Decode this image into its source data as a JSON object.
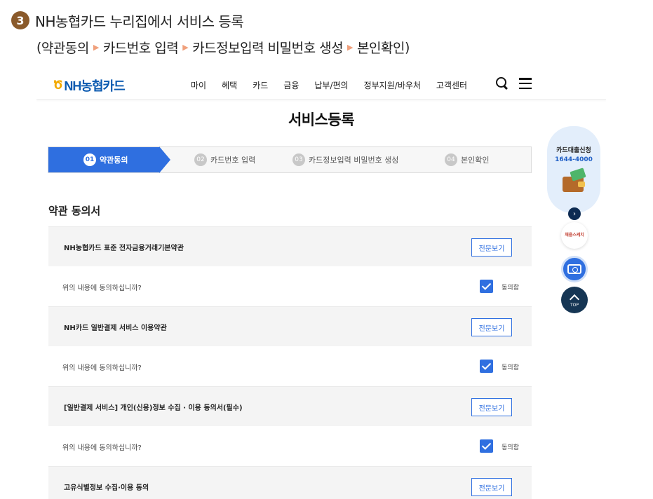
{
  "caption": {
    "step_number": "3",
    "title": "NH농협카드 누리집에서 서비스 등록",
    "flow_open": "(",
    "flow": [
      "약관동의",
      "카드번호 입력",
      "카드정보입력 비밀번호 생성",
      "본인확인"
    ],
    "flow_close": ")",
    "arrow_glyph": "▶"
  },
  "header": {
    "logo_mark": "Ծ",
    "logo_text": "NH농협카드",
    "nav": [
      "마이",
      "혜택",
      "카드",
      "금융",
      "납부/편의",
      "정부지원/바우처",
      "고객센터"
    ],
    "search_icon": "search-icon",
    "menu_icon": "hamburger-icon"
  },
  "page_title": "서비스등록",
  "steps": [
    {
      "num": "01",
      "label": "약관동의",
      "active": true
    },
    {
      "num": "02",
      "label": "카드번호 입력",
      "active": false
    },
    {
      "num": "03",
      "label": "카드정보입력 비밀번호 생성",
      "active": false
    },
    {
      "num": "04",
      "label": "본인확인",
      "active": false
    }
  ],
  "section_title": "약관 동의서",
  "terms": [
    {
      "title": "NH농협카드 표준 전자금융거래기본약관",
      "view_label": "전문보기",
      "question": "위의 내용에 동의하십니까?",
      "agree_label": "동의함",
      "checked": true
    },
    {
      "title": "NH카드 일반결제 서비스 이용약관",
      "view_label": "전문보기",
      "question": "위의 내용에 동의하십니까?",
      "agree_label": "동의함",
      "checked": true
    },
    {
      "title": "[일반결제 서비스] 개인(신용)정보 수집 · 이용 동의서(필수)",
      "view_label": "전문보기",
      "question": "위의 내용에 동의하십니까?",
      "agree_label": "동의함",
      "checked": true
    },
    {
      "title": "고유식별정보 수집·이용 동의",
      "view_label": "전문보기"
    }
  ],
  "quick_menu": {
    "loan_title": "카드대출신청",
    "loan_phone": "1644-4000",
    "next_glyph": "›",
    "sound_label": "채움스케치",
    "top_label": "TOP"
  },
  "colors": {
    "accent": "#2f6fe0",
    "logo_blue": "#0b5ab0",
    "step_badge": "#8a5a2b",
    "caption_arrow": "#f0a07c"
  }
}
